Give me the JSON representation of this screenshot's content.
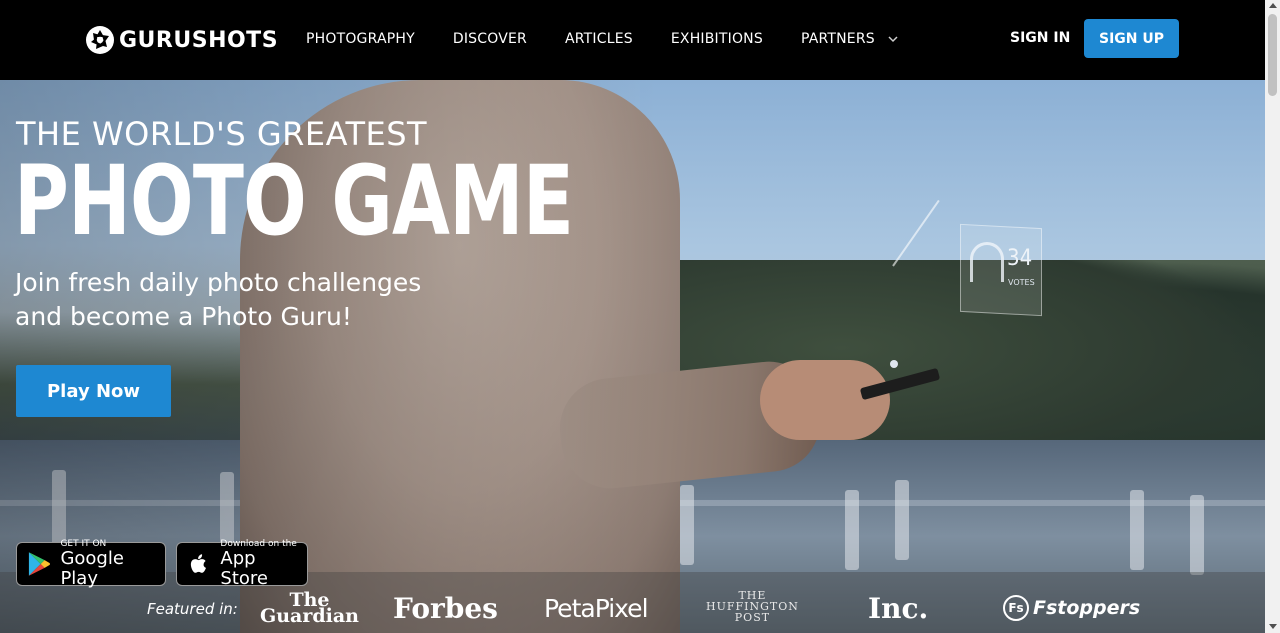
{
  "brand": {
    "name": "GURUSHOTS",
    "logo_icon": "aperture-icon"
  },
  "nav": {
    "links": [
      "PHOTOGRAPHY",
      "DISCOVER",
      "ARTICLES",
      "EXHIBITIONS",
      "PARTNERS"
    ],
    "more_icon": "chevron-down-icon",
    "signin_label": "SIGN IN",
    "signup_label": "SIGN UP"
  },
  "hero": {
    "tagline": "THE WORLD'S GREATEST",
    "headline": "PHOTO GAME",
    "subtitle_line1": "Join fresh daily photo challenges",
    "subtitle_line2": "and become a Photo Guru!",
    "cta_label": "Play Now",
    "hud_votes": "34",
    "hud_votes_label": "VOTES"
  },
  "stores": {
    "google": {
      "small": "GET IT ON",
      "big": "Google Play",
      "icon": "google-play-icon"
    },
    "apple": {
      "small": "Download on the",
      "big": "App Store",
      "icon": "apple-icon"
    }
  },
  "featured": {
    "label": "Featured in:",
    "outlets": {
      "guardian_1": "The",
      "guardian_2": "Guardian",
      "forbes": "Forbes",
      "petapixel": "PetaPixel",
      "huffpost_1": "THE",
      "huffpost_2": "HUFFINGTON",
      "huffpost_3": "POST",
      "inc": "Inc.",
      "fstoppers_mark": "Fs",
      "fstoppers": "Fstoppers"
    }
  },
  "colors": {
    "accent": "#1e88d2",
    "nav_bg": "#000000"
  }
}
